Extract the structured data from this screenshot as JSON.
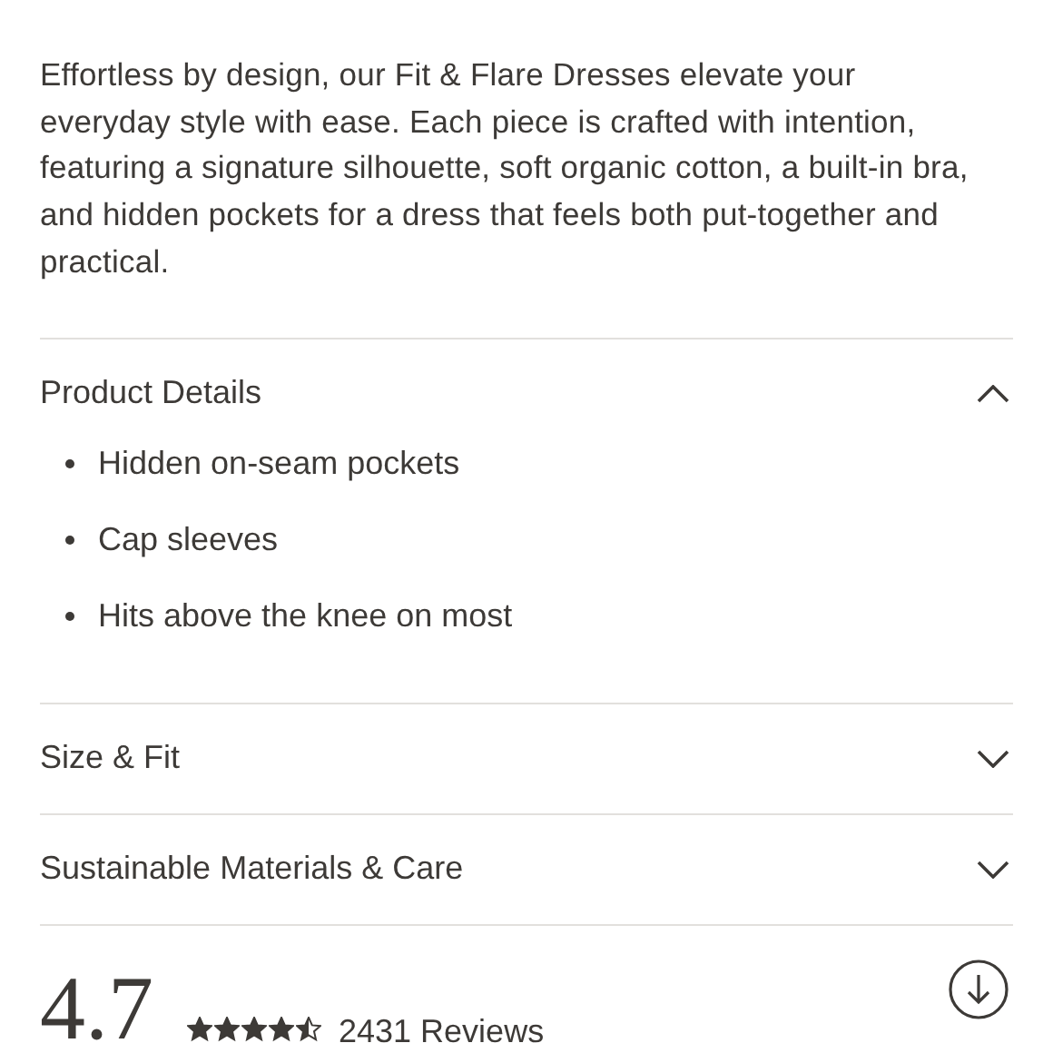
{
  "description": {
    "text": "Effortless by design, our Fit & Flare Dresses elevate your everyday style with ease. Each piece is crafted with intention, featuring a signature silhouette, soft organic cotton, a built-in bra, and hidden pockets for a dress that feels both put-together and practical."
  },
  "sections": [
    {
      "title": "Product Details",
      "expanded": true,
      "items": [
        "Hidden on-seam pockets",
        "Cap sleeves",
        "Hits above the knee on most"
      ]
    },
    {
      "title": "Size & Fit",
      "expanded": false
    },
    {
      "title": "Sustainable Materials & Care",
      "expanded": false
    }
  ],
  "reviews": {
    "rating": "4.7",
    "stars": 4.5,
    "count": "2431 Reviews"
  }
}
